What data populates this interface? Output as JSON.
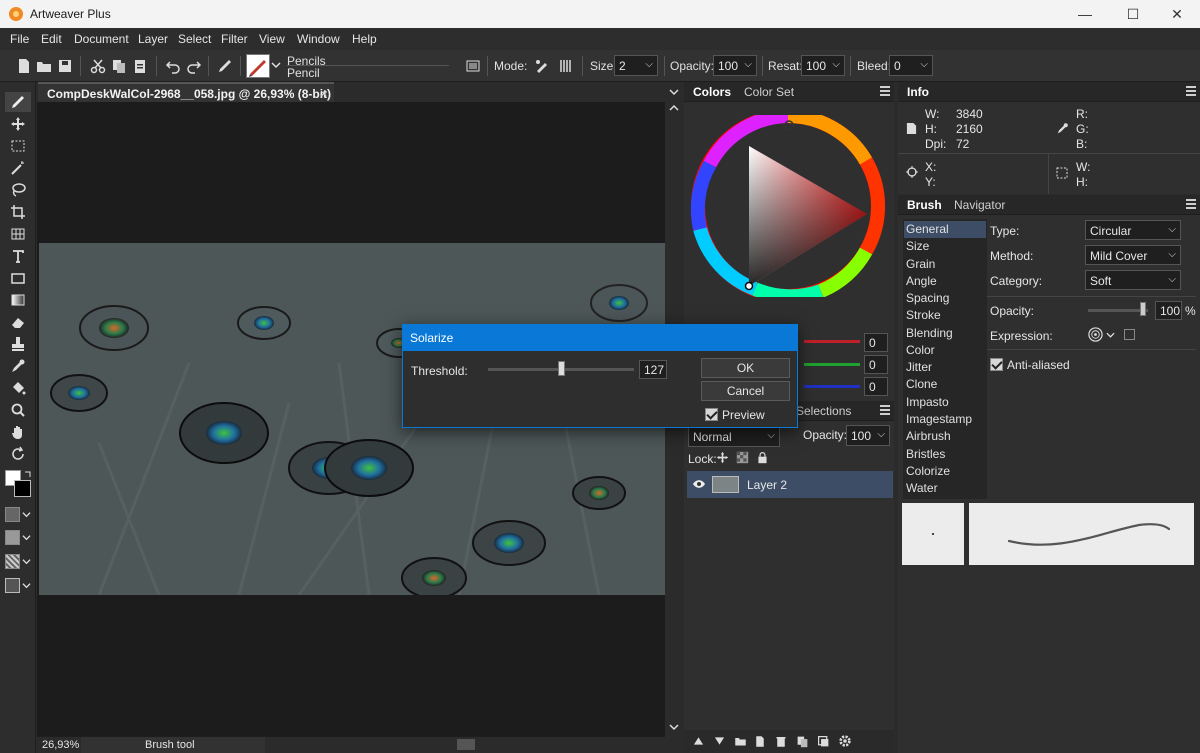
{
  "app": {
    "title": "Artweaver Plus",
    "minimize": "—",
    "maximize": "☐",
    "close": "✕"
  },
  "menu": [
    "File",
    "Edit",
    "Document",
    "Layer",
    "Select",
    "Filter",
    "View",
    "Window",
    "Help"
  ],
  "toolbar": {
    "preset_category": "Pencils",
    "preset_name": "Pencil",
    "mode_label": "Mode:",
    "size_label": "Size:",
    "size_value": "2",
    "opacity_label": "Opacity:",
    "opacity_value": "100",
    "resat_label": "Resat:",
    "resat_value": "100",
    "bleed_label": "Bleed:",
    "bleed_value": "0"
  },
  "document": {
    "tab_title": "CompDeskWalCol-2968__058.jpg @ 26,93% (8-bit) *",
    "tab_close": "×",
    "zoom": "26,93%",
    "status_tool": "Brush tool"
  },
  "colors_panel": {
    "tab_colors": "Colors",
    "tab_colorset": "Color Set",
    "r": "0",
    "g": "0",
    "b": "0"
  },
  "info_panel": {
    "tab": "Info",
    "w_label": "W:",
    "w_value": "3840",
    "h_label": "H:",
    "h_value": "2160",
    "dpi_label": "Dpi:",
    "dpi_value": "72",
    "r_label": "R:",
    "g_label": "G:",
    "b_label": "B:",
    "x_label": "X:",
    "y_label": "Y:",
    "sel_w_label": "W:",
    "sel_h_label": "H:"
  },
  "brush_panel": {
    "tab_brush": "Brush",
    "tab_navigator": "Navigator",
    "categories": [
      "General",
      "Size",
      "Grain",
      "Angle",
      "Spacing",
      "Stroke",
      "Blending",
      "Color",
      "Jitter",
      "Clone",
      "Impasto",
      "Imagestamp",
      "Airbrush",
      "Bristles",
      "Colorize",
      "Water"
    ],
    "selected": "General",
    "type_label": "Type:",
    "type_value": "Circular",
    "method_label": "Method:",
    "method_value": "Mild Cover",
    "category_label": "Category:",
    "category_value": "Soft",
    "opacity_label": "Opacity:",
    "opacity_value": "100",
    "opacity_unit": "%",
    "expression_label": "Expression:",
    "antialiased_label": "Anti-aliased"
  },
  "layers_panel": {
    "tab_selections": "Selections",
    "blend_mode": "Normal",
    "opacity_label": "Opacity:",
    "opacity_value": "100",
    "lock_label": "Lock:",
    "layers": [
      {
        "name": "Layer 2",
        "visible": true
      }
    ]
  },
  "dialog": {
    "title": "Solarize",
    "threshold_label": "Threshold:",
    "threshold_value": "127",
    "threshold_fraction": 0.5,
    "ok": "OK",
    "cancel": "Cancel",
    "preview_label": "Preview"
  },
  "colors": {
    "accent": "#0a78d7",
    "layer_selected": "#3d4d66"
  }
}
